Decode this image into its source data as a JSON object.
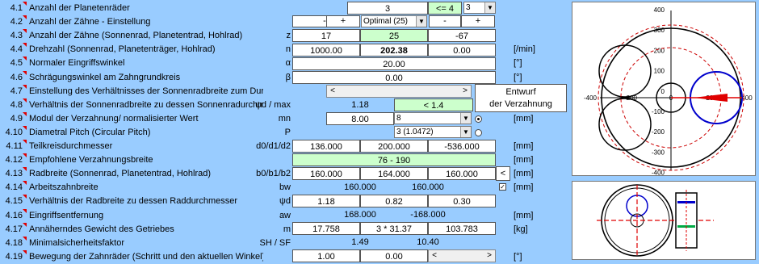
{
  "rows": [
    {
      "num": "4.1",
      "label": "Anzahl der Planetenräder",
      "sym": "",
      "unit": ""
    },
    {
      "num": "4.2",
      "label": "Anzahl der Zähne - Einstellung",
      "sym": "",
      "unit": ""
    },
    {
      "num": "4.3",
      "label": "Anzahl der Zähne (Sonnenrad, Planetentrad, Hohlrad)",
      "sym": "z",
      "unit": ""
    },
    {
      "num": "4.4",
      "label": "Drehzahl (Sonnenrad, Planetenträger, Hohlrad)",
      "sym": "n",
      "unit": "[/min]"
    },
    {
      "num": "4.5",
      "label": "Normaler Eingriffswinkel",
      "sym": "α",
      "unit": "[°]"
    },
    {
      "num": "4.6",
      "label": "Schrägungswinkel am Zahngrundkreis",
      "sym": "β",
      "unit": "[°]"
    },
    {
      "num": "4.7",
      "label": "Einstellung des Verhältnisses der Sonnenradbreite zum Durchmesser",
      "sym": "",
      "unit": ""
    },
    {
      "num": "4.8",
      "label": "Verhältnis der Sonnenradbreite zu dessen Sonnenradurchmesser",
      "sym": "ψd / max",
      "unit": ""
    },
    {
      "num": "4.9",
      "label": "Modul der Verzahnung/ normalisierter Wert",
      "sym": "mn",
      "unit": "[mm]"
    },
    {
      "num": "4.10",
      "label": "Diametral Pitch (Circular Pitch)",
      "sym": "P",
      "unit": ""
    },
    {
      "num": "4.11",
      "label": "Teilkreisdurchmesser",
      "sym": "d0/d1/d2",
      "unit": "[mm]"
    },
    {
      "num": "4.12",
      "label": "Empfohlene Verzahnungsbreite",
      "sym": "",
      "unit": "[mm]"
    },
    {
      "num": "4.13",
      "label": "Radbreite (Sonnenrad, Planetentrad, Hohlrad)",
      "sym": "b0/b1/b2",
      "unit": "[mm]"
    },
    {
      "num": "4.14",
      "label": "Arbeitszahnbreite",
      "sym": "bw",
      "unit": "[mm]"
    },
    {
      "num": "4.15",
      "label": "Verhältnis der Radbreite zu dessen Raddurchmesser",
      "sym": "ψd",
      "unit": ""
    },
    {
      "num": "4.16",
      "label": "Eingriffsentfernung",
      "sym": "aw",
      "unit": "[mm]"
    },
    {
      "num": "4.17",
      "label": "Annäherndes Gewicht des Getriebes",
      "sym": "m",
      "unit": "[kg]"
    },
    {
      "num": "4.18",
      "label": "Minimalsicherheitsfaktor",
      "sym": "SH / SF",
      "unit": ""
    },
    {
      "num": "4.19",
      "label": "Bewegung der Zahnräder (Schritt und den aktuellen Winkel)",
      "sym": "",
      "unit": "[°]"
    }
  ],
  "values": {
    "r1_count": "3",
    "r1_limit": "<= 4",
    "r1_select": "3",
    "r2_minus": "-",
    "r2_plus": "+",
    "r2_select": "Optimal (25)",
    "r2_minus2": "-",
    "r2_plus2": "+",
    "r3_a": "17",
    "r3_b": "25",
    "r3_c": "-67",
    "r4_a": "1000.00",
    "r4_b": "202.38",
    "r4_c": "0.00",
    "r5": "20.00",
    "r6": "0.00",
    "r8_a": "1.18",
    "r8_b": "< 1.4",
    "r9_a": "8.00",
    "r9_select": "8",
    "r10_select": "3   (1.0472)",
    "r11_a": "136.000",
    "r11_b": "200.000",
    "r11_c": "-536.000",
    "r12": "76 - 190",
    "r13_a": "160.000",
    "r13_b": "164.000",
    "r13_c": "160.000",
    "r13_btn": "<",
    "r14_a": "160.000",
    "r14_b": "160.000",
    "r15_a": "1.18",
    "r15_b": "0.82",
    "r15_c": "0.30",
    "r16_a": "168.000",
    "r16_b": "-168.000",
    "r17_a": "17.758",
    "r17_b": "3 * 31.37",
    "r17_c": "103.783",
    "r18_a": "1.49",
    "r18_b": "10.40",
    "r19_a": "1.00",
    "r19_b": "0.00"
  },
  "design_button": {
    "line1": "Entwurf",
    "line2": "der Verzahnung"
  },
  "chart1": {
    "x_ticks": [
      "-400",
      "-200",
      "0",
      "200",
      "400"
    ],
    "y_ticks": [
      "400",
      "300",
      "200",
      "100",
      "0",
      "-100",
      "-200",
      "-300",
      "-400"
    ]
  },
  "colors": {
    "accent_red": "#E00000",
    "cell_green": "#CCFFCC",
    "background": "#99CCFF",
    "gear_blue": "#0000CC"
  }
}
